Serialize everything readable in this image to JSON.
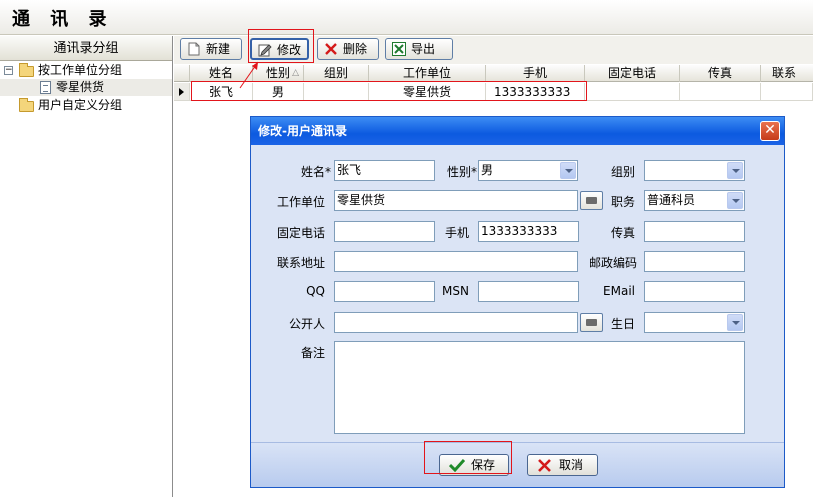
{
  "app": {
    "title": "通 讯 录"
  },
  "sidebar": {
    "header": "通讯录分组",
    "tree": {
      "group_by_company": "按工作单位分组",
      "company_item": "零星供货",
      "custom_group": "用户自定义分组",
      "expander_symbol": "−"
    }
  },
  "toolbar": {
    "new_label": "新建",
    "edit_label": "修改",
    "delete_label": "删除",
    "export_label": "导出"
  },
  "grid": {
    "columns": [
      "姓名",
      "性别",
      "组别",
      "工作单位",
      "手机",
      "固定电话",
      "传真",
      "联系"
    ],
    "sort_indicator": "△",
    "rows": [
      {
        "name": "张飞",
        "gender": "男",
        "group": "",
        "company": "零星供货",
        "mobile": "1333333333",
        "phone": "",
        "fax": "",
        "address": ""
      }
    ]
  },
  "dialog": {
    "title": "修改-用户通讯录",
    "close_symbol": "✕",
    "labels": {
      "name": "姓名*",
      "gender": "性别*",
      "group": "组别",
      "company": "工作单位",
      "position": "职务",
      "phone": "固定电话",
      "mobile": "手机",
      "fax": "传真",
      "address": "联系地址",
      "postcode": "邮政编码",
      "qq": "QQ",
      "msn": "MSN",
      "email": "EMail",
      "public_to": "公开人",
      "birthday": "生日",
      "remark": "备注"
    },
    "values": {
      "name": "张飞",
      "gender": "男",
      "group": "",
      "company": "零星供货",
      "position": "普通科员",
      "phone": "",
      "mobile": "1333333333",
      "fax": "",
      "address": "",
      "postcode": "",
      "qq": "",
      "msn": "",
      "email": "",
      "public_to": "",
      "birthday": "",
      "remark": ""
    },
    "buttons": {
      "save_label": "保存",
      "cancel_label": "取消"
    }
  },
  "colors": {
    "highlight_box": "#e2151b",
    "dialog_title_bar": "#0c5ae0",
    "dialog_body": "#dbe4f5"
  }
}
